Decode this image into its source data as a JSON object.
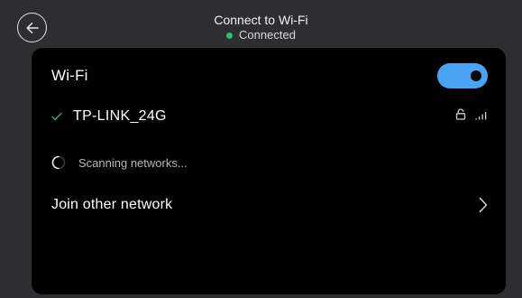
{
  "header": {
    "title": "Connect to Wi-Fi",
    "status": "Connected",
    "status_color": "#2fbf71",
    "back_icon": "arrow-left-icon"
  },
  "wifi": {
    "label": "Wi-Fi",
    "enabled": true,
    "toggle_color": "#4aa3f4"
  },
  "connected_network": {
    "name": "TP-LINK_24G",
    "connected": true,
    "secured": true,
    "icons": [
      "checkmark-icon",
      "lock-icon",
      "signal-strength-icon"
    ]
  },
  "scanning": {
    "text": "Scanning networks..."
  },
  "join_other": {
    "label": "Join other network",
    "icon": "chevron-right-icon"
  }
}
